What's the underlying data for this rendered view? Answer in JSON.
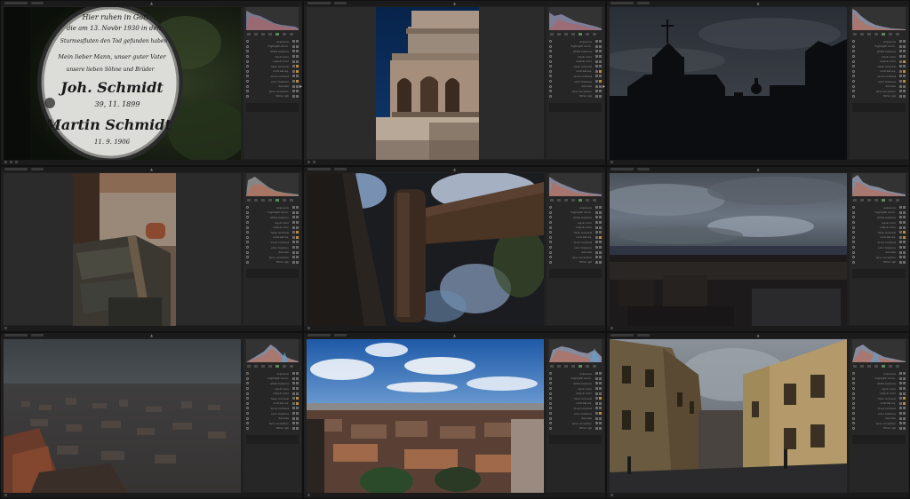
{
  "app": {
    "accent_color": "#5a8a5a"
  },
  "panels": [
    {
      "name": "cell-1"
    },
    {
      "name": "cell-2"
    },
    {
      "name": "cell-3"
    },
    {
      "name": "cell-4"
    },
    {
      "name": "cell-5"
    },
    {
      "name": "cell-6"
    },
    {
      "name": "cell-7"
    },
    {
      "name": "cell-8"
    },
    {
      "name": "cell-9"
    }
  ],
  "module_labels": [
    "exposure",
    "highlight recon.",
    "white balance",
    "input color",
    "output color",
    "haze removal",
    "contrast eq.",
    "local contrast",
    "color balance",
    "denoise",
    "lens correction",
    "filmic rgb",
    "tone equalizer"
  ],
  "photos": {
    "p1": {
      "texts": [
        "Hier ruhen in Gott",
        "die am 13. Novbr 1930 in den",
        "Sturmesfluten den Tod gefunden haben",
        "Mein lieber Mann, unser guter Vater",
        "unsere lieben Söhne und Brüder",
        "Joh. Schmidt",
        "39, 11. 1899",
        "Martin Schmidt",
        "11. 9. 1906"
      ]
    }
  }
}
